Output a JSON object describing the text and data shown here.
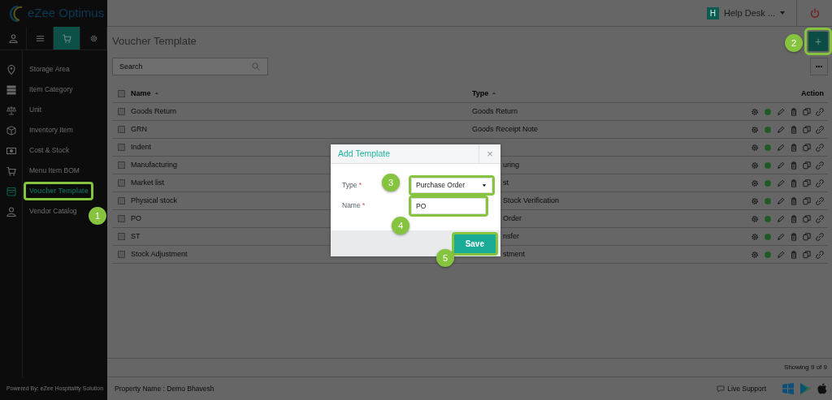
{
  "brand": {
    "name": "eZee Optimus"
  },
  "sidebar_tabs": [
    {
      "selected": false
    },
    {
      "selected": false
    },
    {
      "selected": true
    },
    {
      "selected": false
    }
  ],
  "sidebar": {
    "items": [
      {
        "label": "Storage Area",
        "selected": false,
        "highlighted": false
      },
      {
        "label": "Item Category",
        "selected": false,
        "highlighted": false
      },
      {
        "label": "Unit",
        "selected": false,
        "highlighted": false
      },
      {
        "label": "Inventory Item",
        "selected": false,
        "highlighted": false
      },
      {
        "label": "Cost & Stock",
        "selected": false,
        "highlighted": false
      },
      {
        "label": "Menu Item BOM",
        "selected": false,
        "highlighted": false
      },
      {
        "label": "Voucher Template",
        "selected": true,
        "highlighted": true
      },
      {
        "label": "Vendor Catalog",
        "selected": false,
        "highlighted": false
      }
    ],
    "footer": "Powered By: eZee Hospitality Solution"
  },
  "topbar": {
    "badge": "H",
    "user": "Help Desk ..."
  },
  "page": {
    "title": "Voucher Template",
    "add_highlighted": true,
    "add_label": "+",
    "more_label": "•••"
  },
  "search": {
    "placeholder": "Search"
  },
  "table": {
    "columns": [
      "Name",
      "Type",
      "Action"
    ],
    "select_all_checked": false,
    "rows": [
      {
        "name": "Goods Return",
        "type": "Goods Return",
        "checked": false
      },
      {
        "name": "GRN",
        "type": "Goods Receipt Note",
        "checked": false
      },
      {
        "name": "Indent",
        "checked": false
      },
      {
        "name": "Manufacturing",
        "type": "uring",
        "checked": false
      },
      {
        "name": "Market list",
        "type": "st",
        "checked": false
      },
      {
        "name": "Physical stock",
        "type": "Stock Verification",
        "checked": false
      },
      {
        "name": "PO",
        "type": "Order",
        "checked": false
      },
      {
        "name": "ST",
        "type": "nsfer",
        "checked": false
      },
      {
        "name": "Stock Adjustment",
        "type": "stment",
        "checked": false
      }
    ]
  },
  "pagination": "Showing 9 of 9",
  "footer": {
    "property": "Property Name : Demo Bhavesh",
    "support": "Live Support"
  },
  "modal": {
    "title": "Add Template",
    "close": "×",
    "fields": [
      {
        "label": "Type",
        "required": "*",
        "kind": "select",
        "value": "Purchase Order",
        "highlighted": true
      },
      {
        "label": "Name",
        "required": "*",
        "kind": "text",
        "value": "PO",
        "highlighted": true
      }
    ],
    "save": "Save",
    "save_highlighted": true
  },
  "callouts": [
    "1",
    "2",
    "3",
    "4",
    "5"
  ]
}
